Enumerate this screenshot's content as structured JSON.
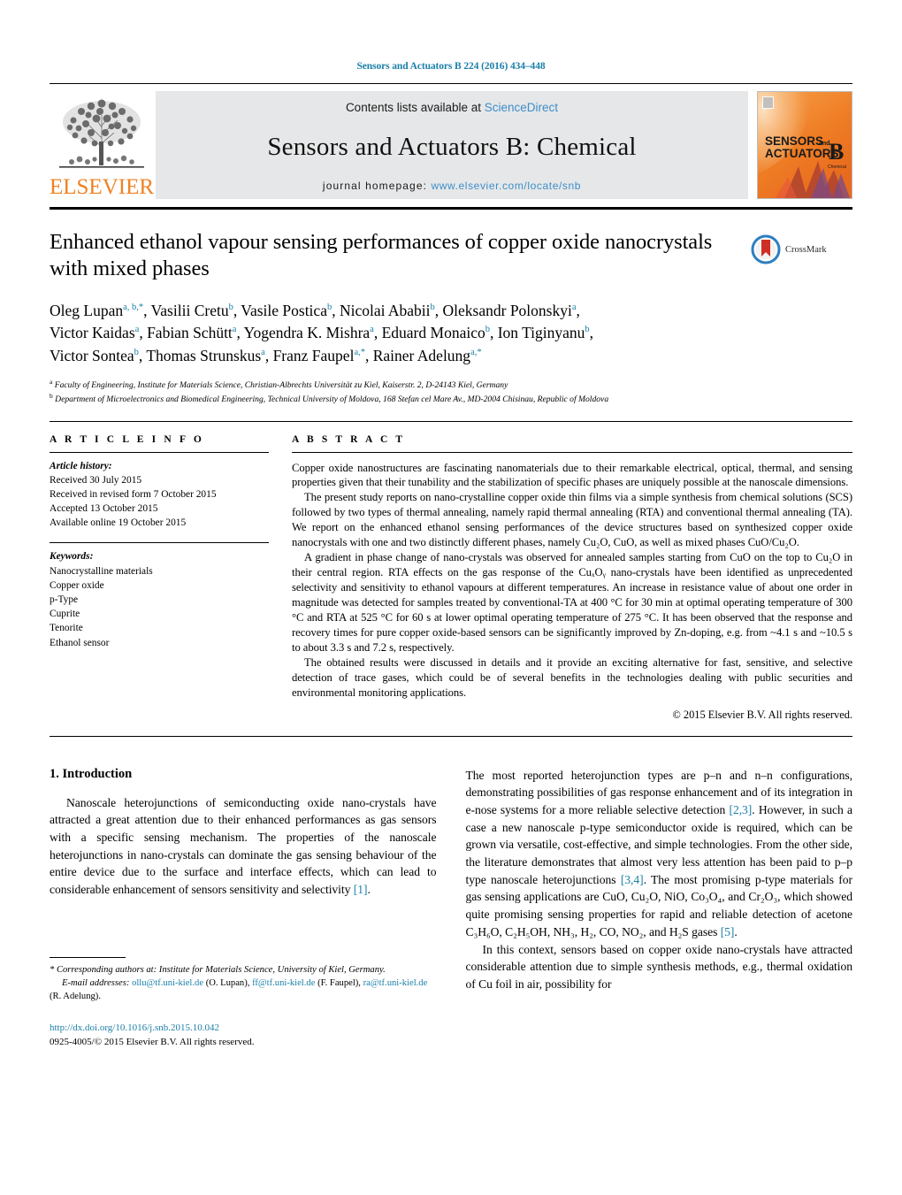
{
  "running_head": "Sensors and Actuators B 224 (2016) 434–448",
  "masthead": {
    "publisher": "ELSEVIER",
    "contents_prefix": "Contents lists available at ",
    "contents_link": "ScienceDirect",
    "journal_title": "Sensors and Actuators B: Chemical",
    "homepage_prefix": "journal homepage: ",
    "homepage_link": "www.elsevier.com/locate/snb",
    "cover_line1": "SENSORS",
    "cover_and": "and",
    "cover_line2": "ACTUATORS",
    "cover_letter": "B",
    "cover_sub": "Chemical"
  },
  "article": {
    "title": "Enhanced ethanol vapour sensing performances of copper oxide nanocrystals with mixed phases",
    "crossmark_label": "CrossMark",
    "authors_line1": "Oleg Lupan",
    "authors_html": "Oleg Lupan<sup>a, b,*</sup>, Vasilii Cretu<sup>b</sup>, Vasile Postica<sup>b</sup>, Nicolai Ababii<sup>b</sup>, Oleksandr Polonskyi<sup>a</sup>, Victor Kaidas<sup>a</sup>, Fabian Schütt<sup>a</sup>, Yogendra K. Mishra<sup>a</sup>, Eduard Monaico<sup>b</sup>, Ion Tiginyanu<sup>b</sup>, Victor Sontea<sup>b</sup>, Thomas Strunskus<sup>a</sup>, Franz Faupel<sup>a,*</sup>, Rainer Adelung<sup>a,*</sup>",
    "affiliation_a": "Faculty of Engineering, Institute for Materials Science, Christian-Albrechts Universität zu Kiel, Kaiserstr. 2, D-24143 Kiel, Germany",
    "affiliation_b": "Department of Microelectronics and Biomedical Engineering, Technical University of Moldova, 168 Stefan cel Mare Av., MD-2004 Chisinau, Republic of Moldova"
  },
  "article_info": {
    "heading": "A R T I C L E   I N F O",
    "history_label": "Article history:",
    "history": [
      "Received 30 July 2015",
      "Received in revised form 7 October 2015",
      "Accepted 13 October 2015",
      "Available online 19 October 2015"
    ],
    "keywords_label": "Keywords:",
    "keywords": [
      "Nanocrystalline materials",
      "Copper oxide",
      "p-Type",
      "Cuprite",
      "Tenorite",
      "Ethanol sensor"
    ]
  },
  "abstract": {
    "heading": "A B S T R A C T",
    "paragraphs": [
      "Copper oxide nanostructures are fascinating nanomaterials due to their remarkable electrical, optical, thermal, and sensing properties given that their tunability and the stabilization of specific phases are uniquely possible at the nanoscale dimensions.",
      "The present study reports on nano-crystalline copper oxide thin films via a simple synthesis from chemical solutions (SCS) followed by two types of thermal annealing, namely rapid thermal annealing (RTA) and conventional thermal annealing (TA). We report on the enhanced ethanol sensing performances of the device structures based on synthesized copper oxide nanocrystals with one and two distinctly different phases, namely Cu₂O, CuO, as well as mixed phases CuO/Cu₂O.",
      "A gradient in phase change of nano-crystals was observed for annealed samples starting from CuO on the top to Cu₂O in their central region. RTA effects on the gas response of the CuₓOᵧ nano-crystals have been identified as unprecedented selectivity and sensitivity to ethanol vapours at different temperatures. An increase in resistance value of about one order in magnitude was detected for samples treated by conventional-TA at 400 °C for 30 min at optimal operating temperature of 300 °C and RTA at 525 °C for 60 s at lower optimal operating temperature of 275 °C. It has been observed that the response and recovery times for pure copper oxide-based sensors can be significantly improved by Zn-doping, e.g. from ~4.1 s and ~10.5 s to about 3.3 s and 7.2 s, respectively.",
      "The obtained results were discussed in details and it provide an exciting alternative for fast, sensitive, and selective detection of trace gases, which could be of several benefits in the technologies dealing with public securities and environmental monitoring applications."
    ],
    "copyright": "© 2015 Elsevier B.V. All rights reserved."
  },
  "introduction": {
    "section_number_title": "1.  Introduction",
    "left_paragraph": "Nanoscale heterojunctions of semiconducting oxide nano-crystals have attracted a great attention due to their enhanced performances as gas sensors with a specific sensing mechanism. The properties of the nanoscale heterojunctions in nano-crystals can dominate the gas sensing behaviour of the entire device due to the surface and interface effects, which can lead to considerable enhancement of sensors sensitivity and selectivity [1].",
    "right_paragraph_1": "The most reported heterojunction types are p–n and n–n configurations, demonstrating possibilities of gas response enhancement and of its integration in e-nose systems for a more reliable selective detection [2,3]. However, in such a case a new nanoscale p-type semiconductor oxide is required, which can be grown via versatile, cost-effective, and simple technologies. From the other side, the literature demonstrates that almost very less attention has been paid to p–p type nanoscale heterojunctions [3,4]. The most promising p-type materials for gas sensing applications are CuO, Cu₂O, NiO, Co₃O₄, and Cr₂O₃, which showed quite promising sensing properties for rapid and reliable detection of acetone C₃H₆O, C₂H₅OH, NH₃, H₂, CO, NO₂, and H₂S gases [5].",
    "right_paragraph_2": "In this context, sensors based on copper oxide nano-crystals have attracted considerable attention due to simple synthesis methods, e.g., thermal oxidation of Cu foil in air, possibility for"
  },
  "footnote": {
    "corresponding": "* Corresponding authors at: Institute for Materials Science, University of Kiel, Germany.",
    "email_label": "E-mail addresses:",
    "emails": [
      {
        "address": "ollu@tf.uni-kiel.de",
        "name": "(O. Lupan)"
      },
      {
        "address": "ff@tf.uni-kiel.de",
        "name": "(F. Faupel)"
      },
      {
        "address": "ra@tf.uni-kiel.de",
        "name": "(R. Adelung)."
      }
    ],
    "doi": "http://dx.doi.org/10.1016/j.snb.2015.10.042",
    "issn_line": "0925-4005/© 2015 Elsevier B.V. All rights reserved."
  },
  "colors": {
    "link": "#1a7fa8",
    "sciencedirect": "#3d8ec9",
    "elsevier_orange": "#f08123",
    "masthead_bg": "#e6e7e8"
  }
}
